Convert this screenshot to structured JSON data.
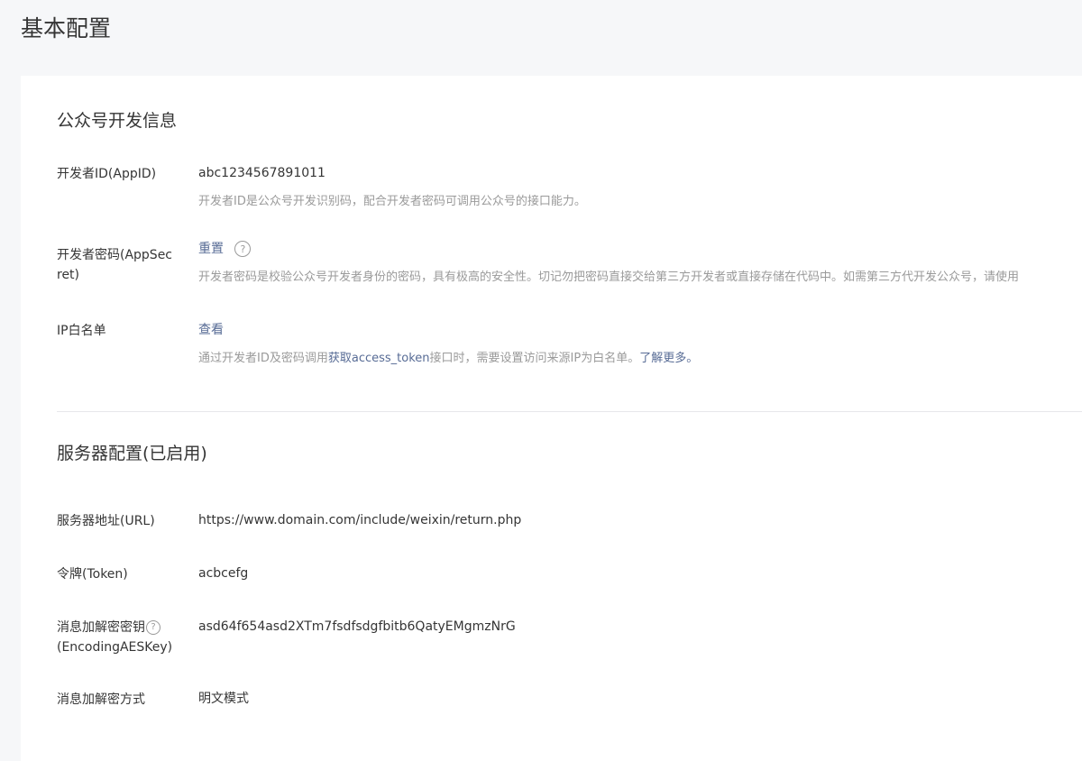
{
  "page": {
    "title": "基本配置"
  },
  "dev_info": {
    "title": "公众号开发信息",
    "appid": {
      "label": "开发者ID(AppID)",
      "value": "abc1234567891011",
      "desc": "开发者ID是公众号开发识别码，配合开发者密码可调用公众号的接口能力。"
    },
    "appsecret": {
      "label": "开发者密码(AppSecret)",
      "action": "重置",
      "desc": "开发者密码是校验公众号开发者身份的密码，具有极高的安全性。切记勿把密码直接交给第三方开发者或直接存储在代码中。如需第三方代开发公众号，请使用"
    },
    "ip_whitelist": {
      "label": "IP白名单",
      "action": "查看",
      "desc_prefix": "通过开发者ID及密码调用",
      "desc_link": "获取access_token",
      "desc_middle": "接口时，需要设置访问来源IP为白名单。",
      "desc_more": "了解更多。"
    }
  },
  "server_config": {
    "title": "服务器配置(已启用)",
    "url": {
      "label": "服务器地址(URL)",
      "value": "https://www.domain.com/include/weixin/return.php"
    },
    "token": {
      "label": "令牌(Token)",
      "value": "acbcefg"
    },
    "aes_key": {
      "label_line1": "消息加解密密钥",
      "label_line2": "(EncodingAESKey)",
      "value": "asd64f654asd2XTm7fsdfsdgfbitb6QatyEMgmzNrG"
    },
    "encrypt_mode": {
      "label": "消息加解密方式",
      "value": "明文模式"
    }
  },
  "icons": {
    "help": "?"
  },
  "colors": {
    "link": "#576b95",
    "desc": "#9a9a9a",
    "background": "#f6f7f9",
    "divider": "#e7e7eb"
  }
}
